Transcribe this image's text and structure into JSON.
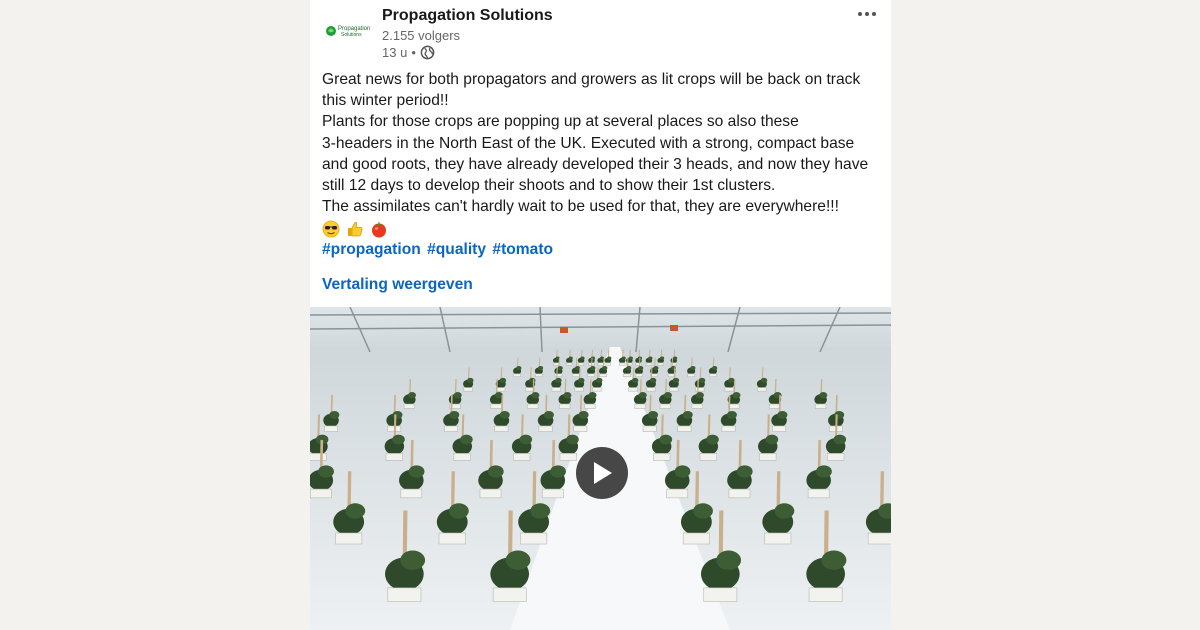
{
  "post": {
    "author": {
      "name": "Propagation Solutions",
      "followers": "2.155 volgers",
      "time": "13 u",
      "separator": "•",
      "logo_text_line1": "Propagation",
      "logo_text_line2": "Solutions"
    },
    "body": {
      "line1": "Great news for both propagators and growers as lit crops will be back on track this winter period!!",
      "line2": "Plants for those crops are popping up at several places so also these",
      "line3": "3-headers in the North East of the UK. Executed with a strong, compact base and good roots, they have already developed their 3 heads, and now they have still 12 days to develop their shoots and to show their 1st clusters.",
      "line4": "The assimilates can't hardly wait to be used for that, they are everywhere!!!",
      "emojis": [
        "sunglasses-face",
        "thumbs-up",
        "tomato"
      ],
      "hashtags": [
        "#propagation",
        "#quality",
        "#tomato"
      ]
    },
    "translate_label": "Vertaling weergeven",
    "icons": {
      "more": "more-horizontal-icon",
      "globe": "globe-icon",
      "play": "play-icon"
    },
    "colors": {
      "link": "#0a66c2",
      "logo_green": "#1e9e3a"
    }
  }
}
